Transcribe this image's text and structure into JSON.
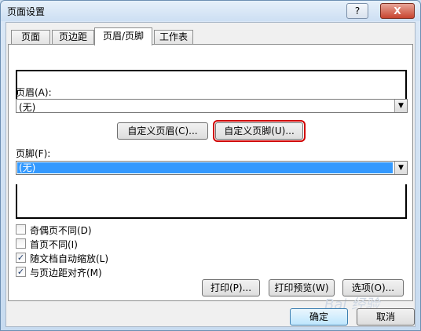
{
  "window": {
    "title": "页面设置",
    "help_label": "?",
    "close_label": "X"
  },
  "tabs": [
    {
      "label": "页面"
    },
    {
      "label": "页边距"
    },
    {
      "label": "页眉/页脚"
    },
    {
      "label": "工作表"
    }
  ],
  "header": {
    "label": "页眉(A):",
    "value": "(无)",
    "custom_button": "自定义页眉(C)..."
  },
  "footer": {
    "custom_button": "自定义页脚(U)...",
    "label": "页脚(F):",
    "value": "(无)"
  },
  "options": [
    {
      "label": "奇偶页不同(D)",
      "checked": false
    },
    {
      "label": "首页不同(I)",
      "checked": false
    },
    {
      "label": "随文档自动缩放(L)",
      "checked": true
    },
    {
      "label": "与页边距对齐(M)",
      "checked": true
    }
  ],
  "actions": {
    "print": "打印(P)...",
    "print_preview": "打印预览(W)",
    "options": "选项(O)..."
  },
  "dialog_buttons": {
    "ok": "确定",
    "cancel": "取消"
  },
  "checkmark": "✓",
  "watermark": "Bai 经验"
}
